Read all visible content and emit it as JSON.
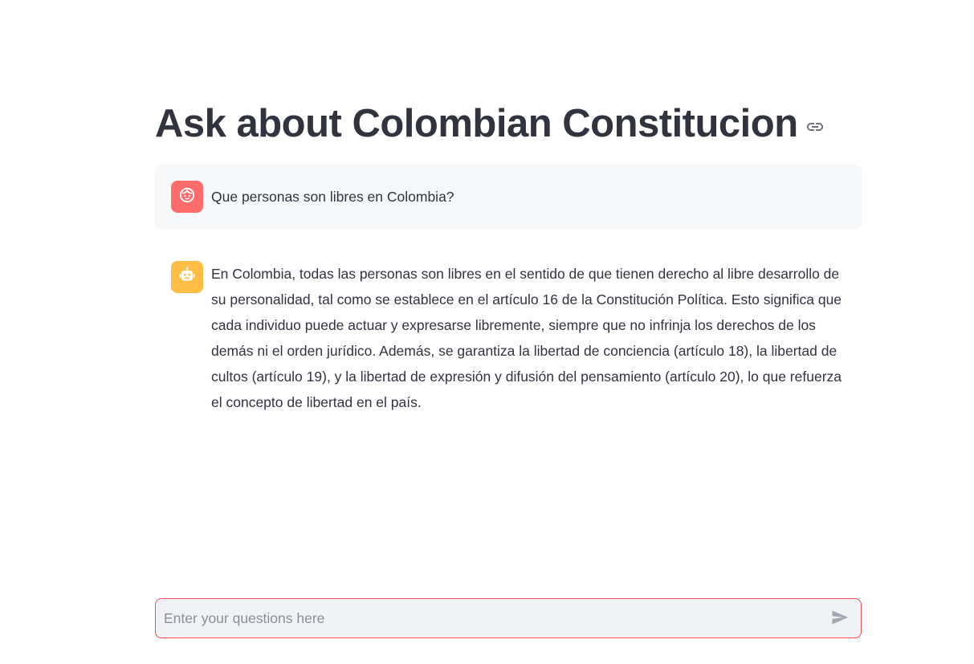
{
  "header": {
    "title": "Ask about Colombian Constitucion",
    "anchor_icon": "link-icon"
  },
  "messages": [
    {
      "role": "user",
      "avatar_icon": "user-face-icon",
      "avatar_color": "#ff6c6c",
      "text": "Que personas son libres en Colombia?"
    },
    {
      "role": "assistant",
      "avatar_icon": "robot-icon",
      "avatar_color": "#ffbd45",
      "text": "En Colombia, todas las personas son libres en el sentido de que tienen derecho al libre desarrollo de su personalidad, tal como se establece en el artículo 16 de la Constitución Política. Esto significa que cada individuo puede actuar y expresarse libremente, siempre que no infrinja los derechos de los demás ni el orden jurídico. Además, se garantiza la libertad de conciencia (artículo 18), la libertad de cultos (artículo 19), y la libertad de expresión y difusión del pensamiento (artículo 20), lo que refuerza el concepto de libertad en el país."
    }
  ],
  "chat_input": {
    "placeholder": "Enter your questions here",
    "value": "",
    "send_icon": "send-icon",
    "focus_border_color": "#ff4b4b"
  },
  "colors": {
    "text": "#31333f",
    "user_message_bg": "#f7f8fa",
    "input_bg": "#f0f2f6"
  }
}
